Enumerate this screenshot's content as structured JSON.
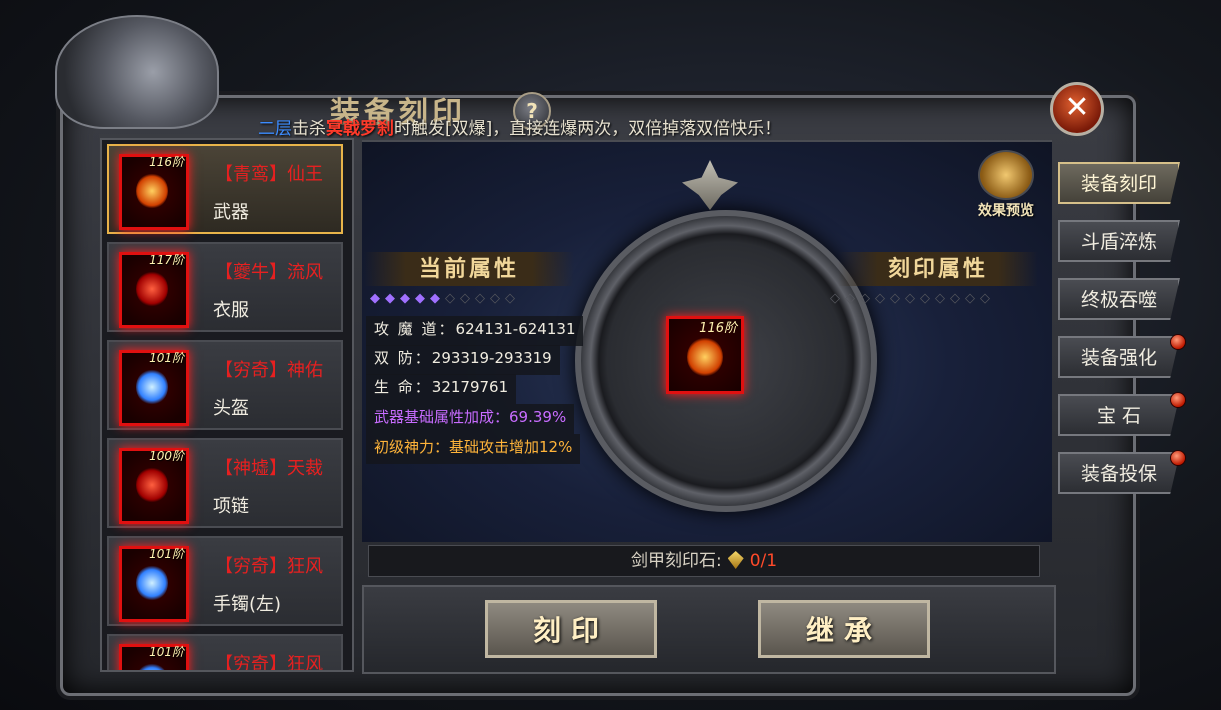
{
  "header": {
    "title": "装备刻印",
    "help_label": "?",
    "close_label": "✕"
  },
  "notice": {
    "floor": "二层",
    "part1": "击杀",
    "boss": "冥戟罗刹",
    "part2": "时触发[双爆]，直接连爆两次，双倍掉落双倍快乐！"
  },
  "equipment_list": [
    {
      "level": "116阶",
      "name": "【青鸾】仙王",
      "type": "武器",
      "gem": "fire",
      "selected": true
    },
    {
      "level": "117阶",
      "name": "【夔牛】流风",
      "type": "衣服",
      "gem": "red",
      "selected": false
    },
    {
      "level": "101阶",
      "name": "【穷奇】神佑",
      "type": "头盔",
      "gem": "blue",
      "selected": false
    },
    {
      "level": "100阶",
      "name": "【神墟】天裁",
      "type": "项链",
      "gem": "red",
      "selected": false
    },
    {
      "level": "101阶",
      "name": "【穷奇】狂风",
      "type": "手镯(左)",
      "gem": "blue",
      "selected": false
    },
    {
      "level": "101阶",
      "name": "【穷奇】狂风",
      "type": "",
      "gem": "blue",
      "selected": false
    }
  ],
  "current_attrs": {
    "title": "当前属性",
    "stars_filled": 5,
    "stars_total": 10,
    "attack_label": "攻 魔 道：",
    "attack_value": "624131-624131",
    "defense_label": "双    防：",
    "defense_value": "293319-293319",
    "hp_label": "生    命：",
    "hp_value": "32179761",
    "bonus": "武器基础属性加成：69.39%",
    "divine": "初级神力：基础攻击增加12%"
  },
  "engrave_attrs": {
    "title": "刻印属性",
    "stars_total": 10
  },
  "center_item": {
    "level": "116阶"
  },
  "preview": {
    "label": "效果预览"
  },
  "stone": {
    "label": "剑甲刻印石:",
    "count": "0/1"
  },
  "buttons": {
    "engrave": "刻印",
    "inherit": "继承"
  },
  "tabs": [
    {
      "label": "装备刻印",
      "active": true,
      "dot": false
    },
    {
      "label": "斗盾淬炼",
      "active": false,
      "dot": false
    },
    {
      "label": "终极吞噬",
      "active": false,
      "dot": false
    },
    {
      "label": "装备强化",
      "active": false,
      "dot": true
    },
    {
      "label": "宝 石",
      "active": false,
      "dot": true
    },
    {
      "label": "装备投保",
      "active": false,
      "dot": true
    }
  ],
  "colors": {
    "accent_gold": "#e8b44a",
    "item_name_red": "#e62020",
    "bonus_purple": "#c86cff",
    "divine_orange": "#ffb43a"
  }
}
